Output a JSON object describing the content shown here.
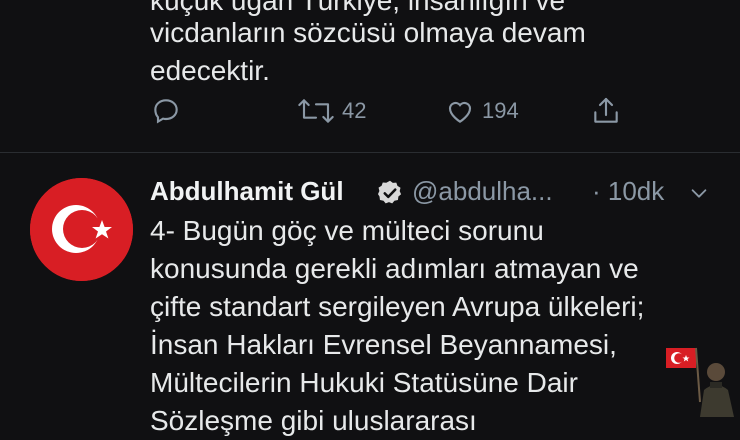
{
  "previous_tweet": {
    "lines": [
      "küçük uğan Türkiye, insanlığın ve",
      "vicdanların sözcüsü olmaya devam",
      "edecektir."
    ],
    "retweet_count": "42",
    "like_count": "194"
  },
  "tweet": {
    "author_name": "Abdulhamit Gül",
    "handle": "@abdulha...",
    "time": "· 10dk",
    "lines": [
      "4- Bugün göç ve mülteci sorunu",
      "konusunda gerekli adımları atmayan ve",
      "çifte standart sergileyen Avrupa ülkeleri;",
      "İnsan Hakları Evrensel Beyannamesi,",
      "Mültecilerin Hukuki Statüsüne Dair",
      "Sözleşme gibi uluslararası"
    ]
  },
  "colors": {
    "background": "#101012",
    "text": "#e7e9ea",
    "muted": "#8b98a5",
    "flag_red": "#d81e24",
    "verified": "#d9d9d9"
  },
  "icons": [
    "reply-icon",
    "retweet-icon",
    "like-icon",
    "share-icon",
    "verified-icon",
    "chevron-down-icon"
  ]
}
